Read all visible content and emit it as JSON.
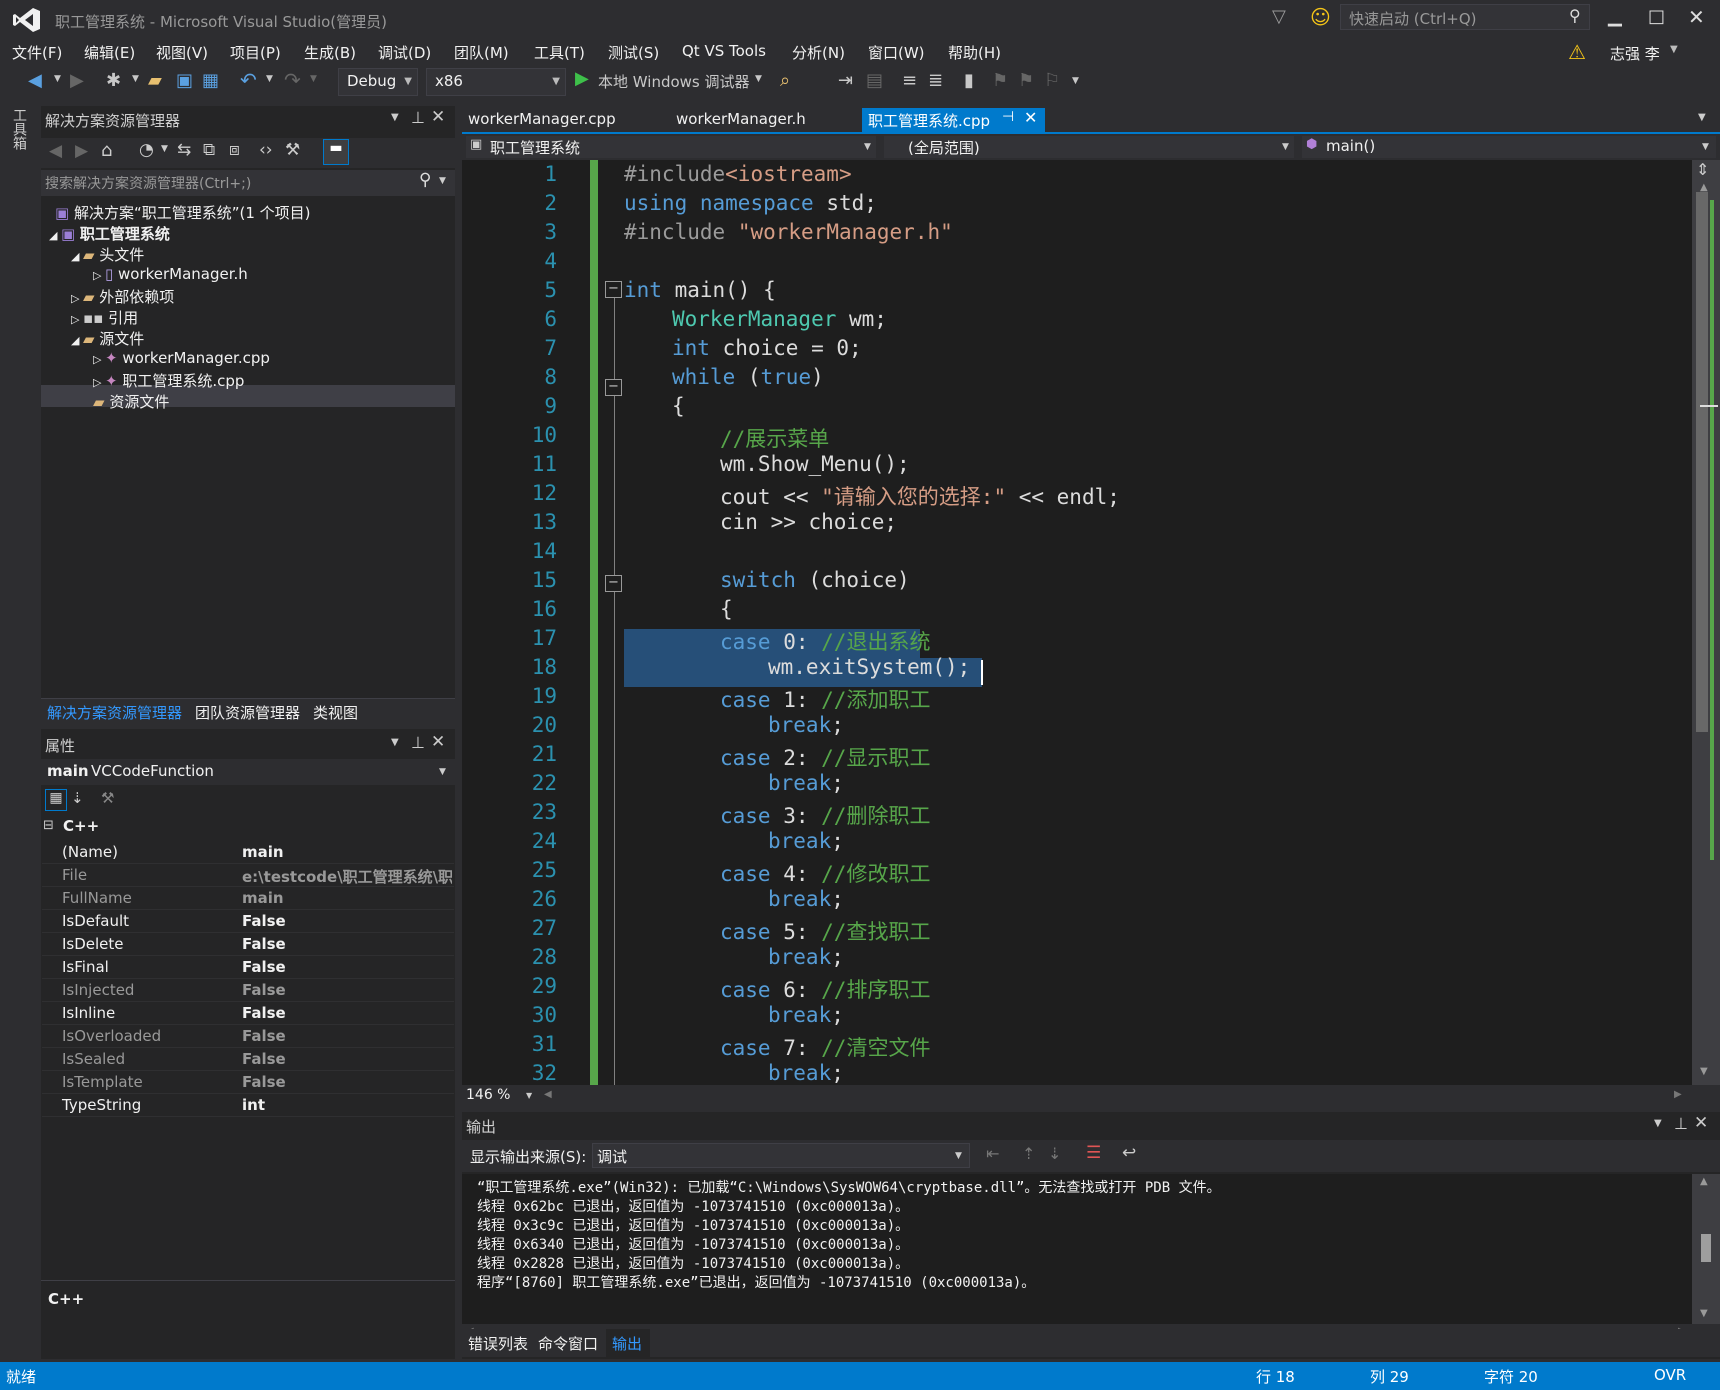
{
  "window": {
    "title": "职工管理系统 - Microsoft Visual Studio(管理员)",
    "quick_launch_placeholder": "快速启动 (Ctrl+Q)",
    "user": "志强 李"
  },
  "menu": [
    "文件(F)",
    "编辑(E)",
    "视图(V)",
    "项目(P)",
    "生成(B)",
    "调试(D)",
    "团队(M)",
    "工具(T)",
    "测试(S)",
    "Qt VS Tools",
    "分析(N)",
    "窗口(W)",
    "帮助(H)"
  ],
  "toolbar": {
    "config": "Debug",
    "platform": "x86",
    "debugger": "本地 Windows 调试器"
  },
  "left_strip": {
    "toolbox": "工具箱"
  },
  "solution_explorer": {
    "title": "解决方案资源管理器",
    "search_placeholder": "搜索解决方案资源管理器(Ctrl+;)",
    "items": [
      {
        "label": "解决方案“职工管理系统”(1 个项目)"
      },
      {
        "label": "职工管理系统"
      },
      {
        "label": "头文件"
      },
      {
        "label": "workerManager.h"
      },
      {
        "label": "外部依赖项"
      },
      {
        "label": "引用"
      },
      {
        "label": "源文件"
      },
      {
        "label": "workerManager.cpp"
      },
      {
        "label": "职工管理系统.cpp"
      },
      {
        "label": "资源文件"
      }
    ],
    "tabs": [
      "解决方案资源管理器",
      "团队资源管理器",
      "类视图"
    ]
  },
  "properties": {
    "title": "属性",
    "object_name": "main",
    "object_type": "VCCodeFunction",
    "category": "C++",
    "rows": [
      {
        "name": "(Name)",
        "value": "main"
      },
      {
        "name": "File",
        "value": "e:\\testcode\\职工管理系统\\职工"
      },
      {
        "name": "FullName",
        "value": "main"
      },
      {
        "name": "IsDefault",
        "value": "False"
      },
      {
        "name": "IsDelete",
        "value": "False"
      },
      {
        "name": "IsFinal",
        "value": "False"
      },
      {
        "name": "IsInjected",
        "value": "False"
      },
      {
        "name": "IsInline",
        "value": "False"
      },
      {
        "name": "IsOverloaded",
        "value": "False"
      },
      {
        "name": "IsSealed",
        "value": "False"
      },
      {
        "name": "IsTemplate",
        "value": "False"
      },
      {
        "name": "TypeString",
        "value": "int"
      }
    ],
    "desc": "C++"
  },
  "editor": {
    "tabs": [
      "workerManager.cpp",
      "workerManager.h",
      "职工管理系统.cpp"
    ],
    "project_dropdown": "职工管理系统",
    "scope_dropdown": "(全局范围)",
    "member_dropdown": "main()",
    "zoom": "146 %"
  },
  "code_lines": [
    "1",
    "2",
    "3",
    "4",
    "5",
    "6",
    "7",
    "8",
    "9",
    "10",
    "11",
    "12",
    "13",
    "14",
    "15",
    "16",
    "17",
    "18",
    "19",
    "20",
    "21",
    "22",
    "23",
    "24",
    "25",
    "26",
    "27",
    "28",
    "29",
    "30",
    "31",
    "32"
  ],
  "code": {
    "l1a": "#include",
    "l1b": "<iostream>",
    "l2a": "using",
    "l2b": "namespace",
    "l2c": " std;",
    "l3a": "#include",
    "l3b": "\"workerManager.h\"",
    "l5a": "int",
    "l5b": " main() {",
    "l6a": "WorkerManager",
    "l6b": " wm;",
    "l7a": "int",
    "l7b": " choice = 0;",
    "l8a": "while",
    "l8b": " (",
    "l8c": "true",
    "l8d": ")",
    "l9": "{",
    "l10": "//展示菜单",
    "l11": "wm.Show_Menu();",
    "l12a": "cout << ",
    "l12b": "\"请输入您的选择:\"",
    "l12c": " << endl;",
    "l13": "cin >> choice;",
    "l15a": "switch",
    "l15b": " (choice)",
    "l16": "{",
    "l17a": "case",
    "l17b": " 0: ",
    "l17c": "//退出系统",
    "l18": "wm.exitSystem();",
    "l19a": "case",
    "l19b": " 1: ",
    "l19c": "//添加职工",
    "brk": "break",
    "semi": ";",
    "l21a": "case",
    "l21b": " 2: ",
    "l21c": "//显示职工",
    "l23a": "case",
    "l23b": " 3: ",
    "l23c": "//删除职工",
    "l25a": "case",
    "l25b": " 4: ",
    "l25c": "//修改职工",
    "l27a": "case",
    "l27b": " 5: ",
    "l27c": "//查找职工",
    "l29a": "case",
    "l29b": " 6: ",
    "l29c": "//排序职工",
    "l31a": "case",
    "l31b": " 7: ",
    "l31c": "//清空文件"
  },
  "output": {
    "title": "输出",
    "source_label": "显示输出来源(S):",
    "source_value": "调试",
    "lines": [
      "“职工管理系统.exe”(Win32): 已加载“C:\\Windows\\SysWOW64\\cryptbase.dll”。无法查找或打开 PDB 文件。",
      "线程 0x62bc 已退出，返回值为 -1073741510 (0xc000013a)。",
      "线程 0x3c9c 已退出，返回值为 -1073741510 (0xc000013a)。",
      "线程 0x6340 已退出，返回值为 -1073741510 (0xc000013a)。",
      "线程 0x2828 已退出，返回值为 -1073741510 (0xc000013a)。",
      "程序“[8760] 职工管理系统.exe”已退出，返回值为 -1073741510 (0xc000013a)。"
    ],
    "tabs": [
      "错误列表",
      "命令窗口",
      "输出"
    ]
  },
  "status": {
    "ready": "就绪",
    "line": "行 18",
    "col": "列 29",
    "ch": "字符 20",
    "ovr": "OVR"
  },
  "colors": {
    "accent": "#007acc",
    "editor_bg": "#1e1e1e",
    "keyword": "#569cd6",
    "type": "#4ec9b0",
    "string": "#d69d85",
    "comment": "#57a64a"
  }
}
